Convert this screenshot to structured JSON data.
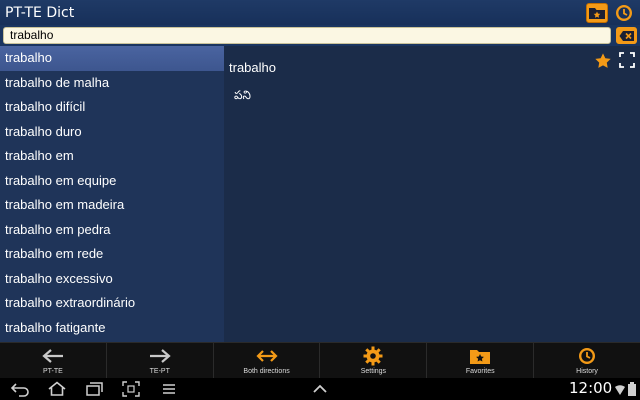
{
  "app": {
    "title": "PT-TE Dict"
  },
  "search": {
    "value": "trabalho"
  },
  "wordlist": {
    "items": [
      "trabalho",
      "trabalho de malha",
      "trabalho difícil",
      "trabalho duro",
      "trabalho em",
      "trabalho em equipe",
      "trabalho em madeira",
      "trabalho em pedra",
      "trabalho em rede",
      "trabalho excessivo",
      "trabalho extraordinário",
      "trabalho fatigante"
    ],
    "selected_index": 0
  },
  "detail": {
    "word": "trabalho",
    "translation": "పని"
  },
  "toolbar": {
    "pt_te": "PT-TE",
    "te_pt": "TE-PT",
    "both": "Both directions",
    "settings": "Settings",
    "favorites": "Favorites",
    "history": "History"
  },
  "status": {
    "time": "12:00"
  },
  "colors": {
    "accent": "#f39a17",
    "list_bg": "#1f3459",
    "detail_bg": "#1b2c49",
    "selected": "#4a64a0"
  }
}
